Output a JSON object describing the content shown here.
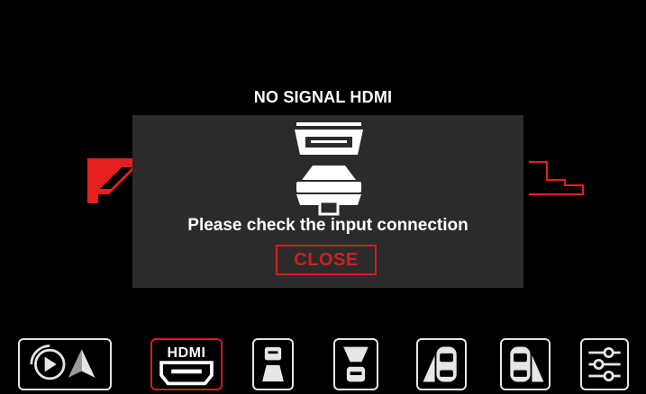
{
  "screen": {
    "signal_title": "NO SIGNAL HDMI"
  },
  "dialog": {
    "message": "Please check the input connection",
    "close_label": "CLOSE",
    "icon": "hdmi-connector-icon"
  },
  "dock": {
    "items": [
      {
        "name": "carplay-android-auto",
        "icon": "carplay-android-icon",
        "active": false
      },
      {
        "name": "hdmi",
        "label": "HDMI",
        "icon": "hdmi-port-icon",
        "active": true
      },
      {
        "name": "front-camera",
        "icon": "front-camera-view-icon",
        "active": false
      },
      {
        "name": "rear-camera",
        "icon": "rear-camera-view-icon",
        "active": false
      },
      {
        "name": "left-camera",
        "icon": "left-camera-view-icon",
        "active": false
      },
      {
        "name": "right-camera",
        "icon": "right-camera-view-icon",
        "active": false
      },
      {
        "name": "settings",
        "icon": "settings-sliders-icon",
        "active": false
      }
    ]
  },
  "colors": {
    "accent": "#d31f1f",
    "dialog_bg": "#2b2b2b",
    "background": "#000000",
    "icon": "#e6e6e6"
  }
}
